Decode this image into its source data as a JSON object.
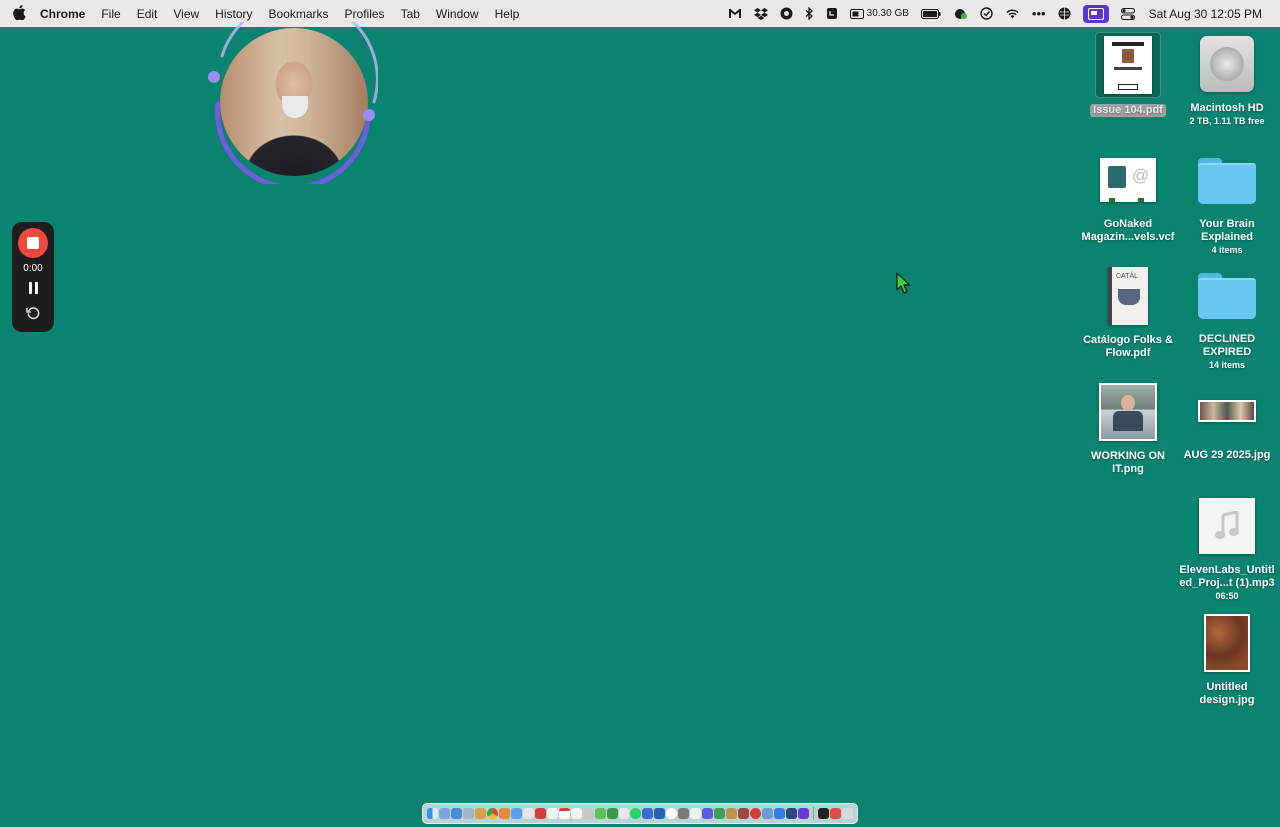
{
  "menubar": {
    "apple": "",
    "items": [
      "Chrome",
      "File",
      "Edit",
      "View",
      "History",
      "Bookmarks",
      "Profiles",
      "Tab",
      "Window",
      "Help"
    ],
    "status": {
      "storage": "30.30 GB",
      "datetime": "Sat Aug 30  12:05 PM"
    }
  },
  "recorder": {
    "time": "0:00",
    "stop_icon": "stop-icon",
    "pause_icon": "pause-icon",
    "restart_icon": "restart-icon"
  },
  "desktop": {
    "icons": [
      {
        "id": "issue104",
        "label": "Issue 104.pdf",
        "kind": "pdf",
        "selected": true
      },
      {
        "id": "macintosh",
        "label": "Macintosh HD",
        "sub": "2 TB, 1.11 TB free",
        "kind": "disk"
      },
      {
        "id": "gonaked",
        "label": "GoNaked\nMagazin...vels.vcf",
        "kind": "vcf"
      },
      {
        "id": "yourbrain",
        "label": "Your Brain\nExplained",
        "sub": "4 items",
        "kind": "folder"
      },
      {
        "id": "catalogo",
        "label": "Catálogo Folks &\nFlow.pdf",
        "kind": "pdf"
      },
      {
        "id": "declined",
        "label": "DECLINED\nEXPIRED",
        "sub": "14 items",
        "kind": "folder"
      },
      {
        "id": "working",
        "label": "WORKING ON\nIT.png",
        "kind": "image"
      },
      {
        "id": "aug29",
        "label": "AUG 29 2025.jpg",
        "kind": "image"
      },
      {
        "id": "elevenlabs",
        "label": "ElevenLabs_Untitl\ned_Proj...t (1).mp3",
        "sub": "06:50",
        "kind": "audio"
      },
      {
        "id": "untitled",
        "label": "Untitled\ndesign.jpg",
        "kind": "image"
      }
    ]
  },
  "colors": {
    "desktop_bg": "#0a8470",
    "menubar_bg": "#e9e9ea",
    "record_red": "#f04a3e",
    "ring_purple": "#6f5ce0"
  }
}
